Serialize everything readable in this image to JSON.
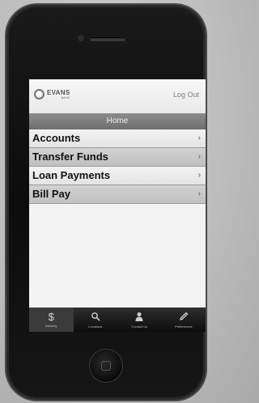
{
  "header": {
    "logo_name": "EVANS",
    "logo_sub": "BANK",
    "logout_label": "Log Out"
  },
  "title": "Home",
  "menu": {
    "items": [
      {
        "label": "Accounts"
      },
      {
        "label": "Transfer Funds"
      },
      {
        "label": "Loan Payments"
      },
      {
        "label": "Bill Pay"
      }
    ],
    "chevron": "›"
  },
  "tabbar": {
    "tabs": [
      {
        "label": "Banking",
        "icon": "dollar-icon"
      },
      {
        "label": "Locations",
        "icon": "search-icon"
      },
      {
        "label": "Contact Us",
        "icon": "person-icon"
      },
      {
        "label": "Preferences",
        "icon": "pen-icon"
      }
    ]
  },
  "colors": {
    "title_bar": "#7a7a7a",
    "tab_bar": "#1a1a1a"
  }
}
